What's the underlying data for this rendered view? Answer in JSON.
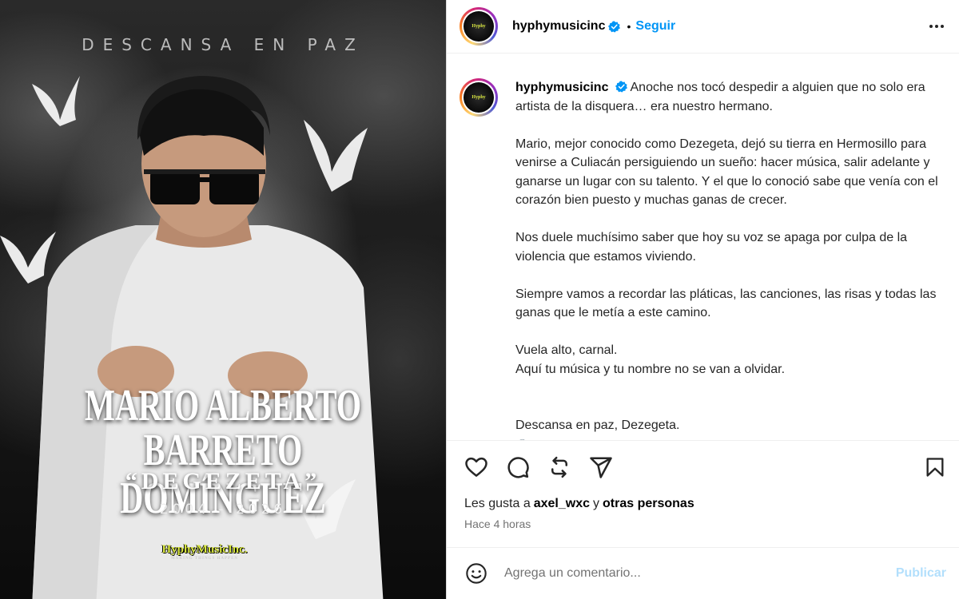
{
  "media": {
    "heading": "DESCANSA EN PAZ",
    "name_line1": "MARIO ALBERTO",
    "name_line2": "BARRETO DOMÍNGUEZ",
    "alias": "“DEGEZETA”",
    "years": "2004 - 2026",
    "logo": "HyphyMusicInc.",
    "logo_tagline": "MAKING THINGS HAPPEN"
  },
  "header": {
    "username": "hyphymusicinc",
    "separator": "•",
    "follow_label": "Seguir",
    "avatar_text": "Hyphy"
  },
  "caption": {
    "username": "hyphymusicinc",
    "paragraphs": [
      "Anoche nos tocó despedir a alguien que no solo era artista de la disquera… era nuestro hermano.",
      "Mario, mejor conocido como Dezegeta, dejó su tierra en Hermosillo para venirse a Culiacán persiguiendo un sueño: hacer música, salir adelante y ganarse un lugar con su talento. Y el que lo conoció sabe que venía con el corazón bien puesto y muchas ganas de crecer.",
      "Nos duele muchísimo saber que hoy su voz se apaga por culpa de la violencia que estamos viviendo.",
      "Siempre vamos a recordar las pláticas, las canciones, las risas y todas las ganas que le metía a este camino.",
      "Vuela alto, carnal.\nAquí tu música y tu nombre no se van a olvidar.",
      "Descansa en paz, Dezegeta."
    ]
  },
  "actions": {
    "like_icon": "heart-icon",
    "comment_icon": "comment-icon",
    "repost_icon": "repost-icon",
    "share_icon": "share-icon",
    "save_icon": "bookmark-icon"
  },
  "likes": {
    "prefix": "Les gusta a",
    "user": "axel_wxc",
    "connector": "y",
    "others": "otras personas"
  },
  "time": "Hace 4 horas",
  "comment": {
    "placeholder": "Agrega un comentario...",
    "publish_label": "Publicar"
  },
  "colors": {
    "accent": "#0095f6",
    "publish_disabled": "#b2dffc",
    "muted": "#737373",
    "logo_yellow": "#d8e640"
  }
}
